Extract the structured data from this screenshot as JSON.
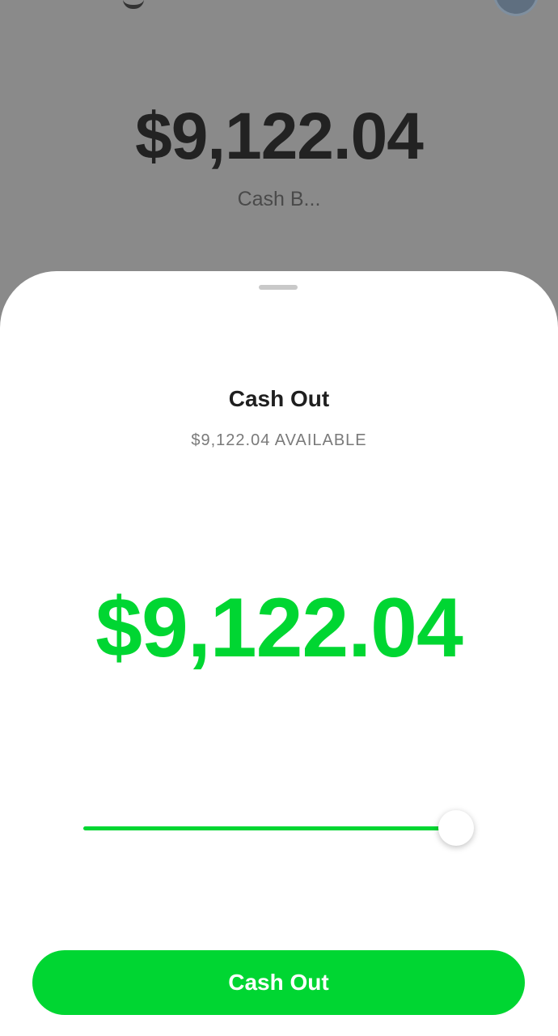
{
  "background": {
    "balance": "$9,122.04",
    "label": "Cash B..."
  },
  "sheet": {
    "title": "Cash Out",
    "available": "$9,122.04 AVAILABLE",
    "amount": "$9,122.04",
    "slider_level": 1.0,
    "button_label": "Cash Out"
  },
  "colors": {
    "accent": "#00d632",
    "overlay": "#8a8a8a",
    "sheet": "#ffffff"
  }
}
